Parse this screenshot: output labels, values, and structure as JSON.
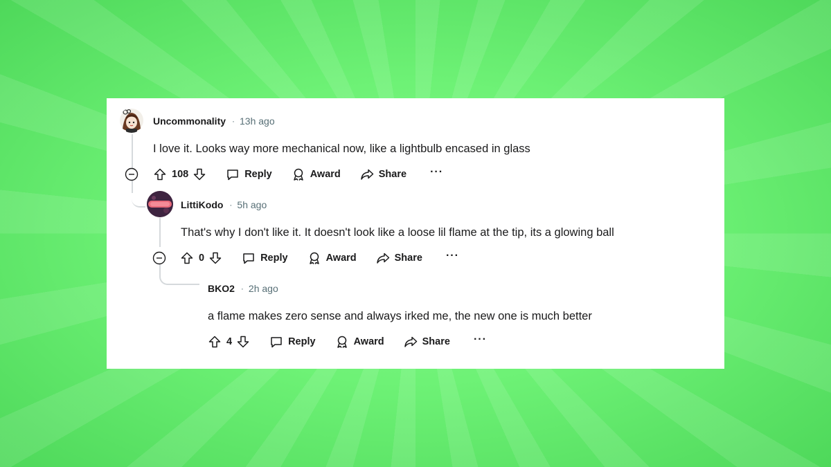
{
  "comments": [
    {
      "username": "Uncommonality",
      "time": "13h ago",
      "text": "I love it. Looks way more mechanical now, like a lightbulb encased in glass",
      "score": "108",
      "reply_label": "Reply",
      "award_label": "Award",
      "share_label": "Share",
      "more_label": "···"
    },
    {
      "username": "LittiKodo",
      "time": "5h ago",
      "text": "That's why I don't like it. It doesn't look like a loose lil flame at the tip, its a glowing ball",
      "score": "0",
      "reply_label": "Reply",
      "award_label": "Award",
      "share_label": "Share",
      "more_label": "···"
    },
    {
      "username": "BKO2",
      "time": "2h ago",
      "text": "a flame makes zero sense and always irked me, the new one is much better",
      "score": "4",
      "reply_label": "Reply",
      "award_label": "Award",
      "share_label": "Share",
      "more_label": "···"
    }
  ],
  "separator": "·",
  "colors": {
    "background": "#6ef276",
    "card": "#ffffff",
    "text": "#1a1a1b",
    "muted": "#576f76",
    "thread_line": "#d5d9dc"
  }
}
